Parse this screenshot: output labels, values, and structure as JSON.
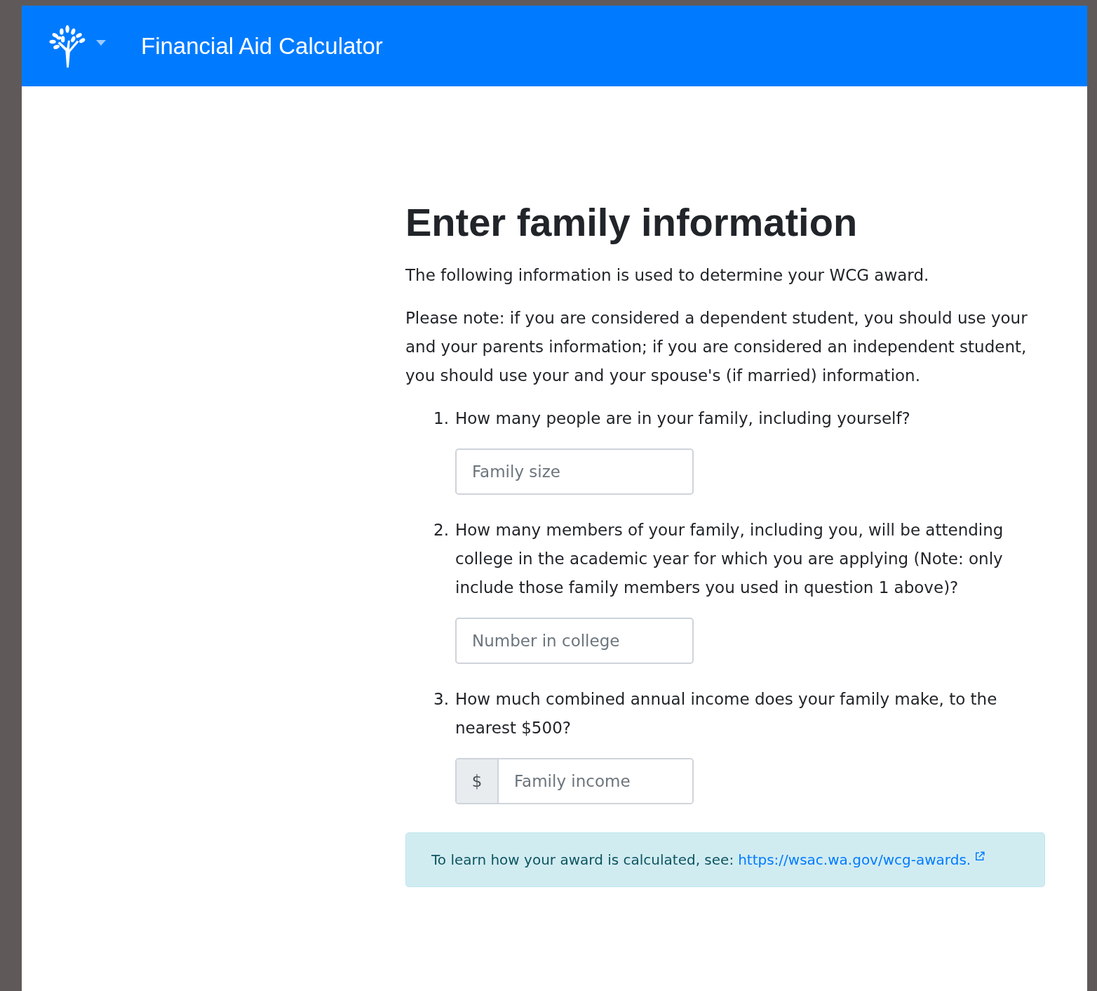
{
  "navbar": {
    "title": "Financial Aid Calculator"
  },
  "heading": "Enter family information",
  "intro": "The following information is used to determine your WCG award.",
  "note": "Please note: if you are considered a dependent student, you should use your and your parents information; if you are considered an independent student, you should use your and your spouse's (if married) information.",
  "questions": [
    {
      "number": "1.",
      "text": "How many people are in your family, including yourself?",
      "placeholder": "Family size"
    },
    {
      "number": "2.",
      "text": "How many members of your family, including you, will be attending college in the academic year for which you are applying (Note: only include those family members you used in question 1 above)?",
      "placeholder": "Number in college"
    },
    {
      "number": "3.",
      "text": "How much combined annual income does your family make, to the nearest $500?",
      "placeholder": "Family income",
      "prefix": "$"
    }
  ],
  "alert": {
    "text": "To learn how your award is calculated, see:",
    "link": "https://wsac.wa.gov/wcg-awards."
  }
}
